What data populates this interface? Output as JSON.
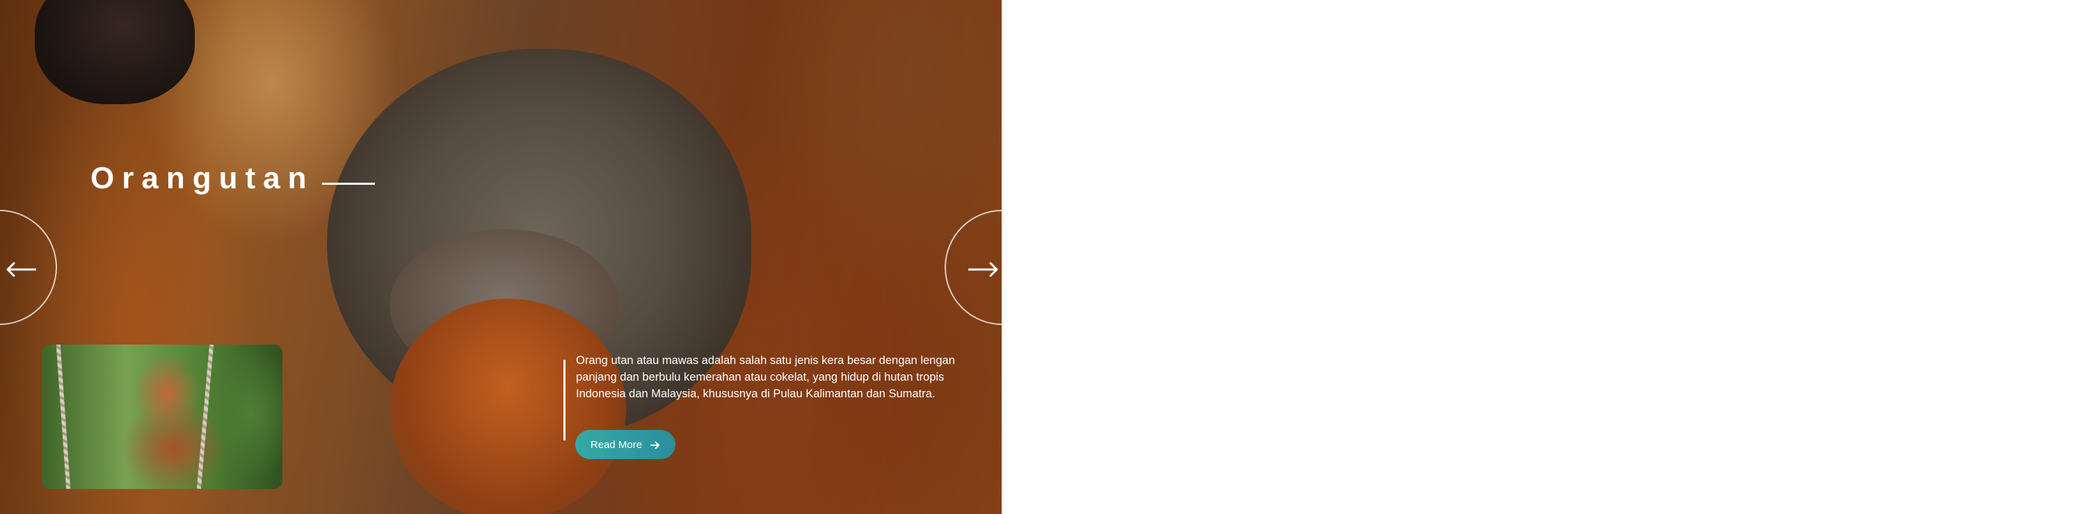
{
  "hero": {
    "title": "Orangutan",
    "description": "Orang utan atau mawas adalah salah satu jenis kera besar dengan lengan panjang dan berbulu kemerahan atau cokelat, yang hidup di hutan tropis Indonesia dan Malaysia, khususnya di Pulau Kalimantan dan Sumatra.",
    "read_more_label": "Read More"
  },
  "navigation": {
    "prev_icon": "arrow-left-icon",
    "next_icon": "arrow-right-icon"
  },
  "colors": {
    "accent": "#2f9ea0",
    "text": "#ffffff"
  }
}
